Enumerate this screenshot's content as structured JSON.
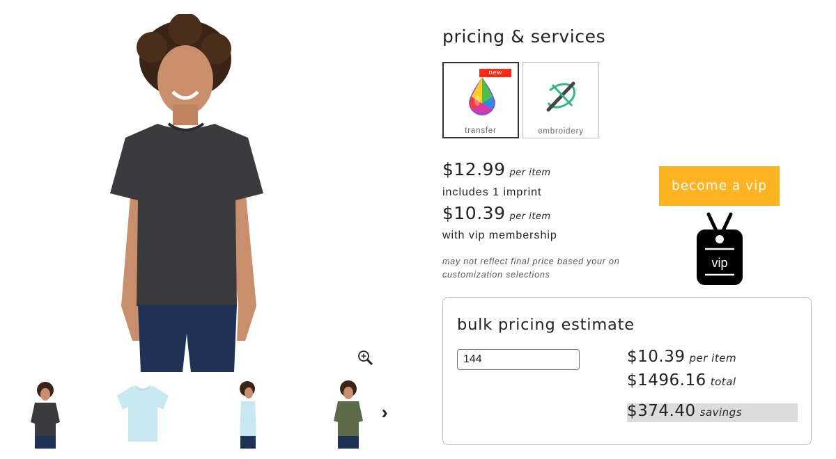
{
  "gallery": {
    "main_image": "youth heather charcoal tee",
    "zoom_icon": "zoom-in-icon",
    "thumbnails": [
      {
        "name": "charcoal-front"
      },
      {
        "name": "light-blue-flat"
      },
      {
        "name": "light-blue-side"
      },
      {
        "name": "olive-front"
      }
    ],
    "next_arrow": "›"
  },
  "pricing": {
    "title": "pricing & services",
    "services": [
      {
        "label": "transfer",
        "badge": "new",
        "selected": true,
        "icon": "color-drop-icon"
      },
      {
        "label": "embroidery",
        "selected": false,
        "icon": "embroidery-needle-icon"
      }
    ],
    "price": "$12.99",
    "price_unit": "per item",
    "includes": "includes 1 imprint",
    "vip_price": "$10.39",
    "vip_price_unit": "per item",
    "vip_note": "with vip membership",
    "disclaimer": "may not reflect final price based your on customization selections",
    "vip_button": "become a vip",
    "vip_tag_text": "vip"
  },
  "bulk": {
    "title": "bulk pricing estimate",
    "quantity": "144",
    "per_item_price": "$10.39",
    "per_item_unit": "per item",
    "total_price": "$1496.16",
    "total_unit": "total",
    "savings": "$374.40",
    "savings_unit": "savings"
  },
  "colors": {
    "accent_orange": "#ffb321",
    "badge_red": "#ff2a14",
    "shirt_charcoal": "#3b3b3d",
    "shirt_light_blue": "#c8e9f2",
    "shirt_olive": "#5c6a4a"
  }
}
